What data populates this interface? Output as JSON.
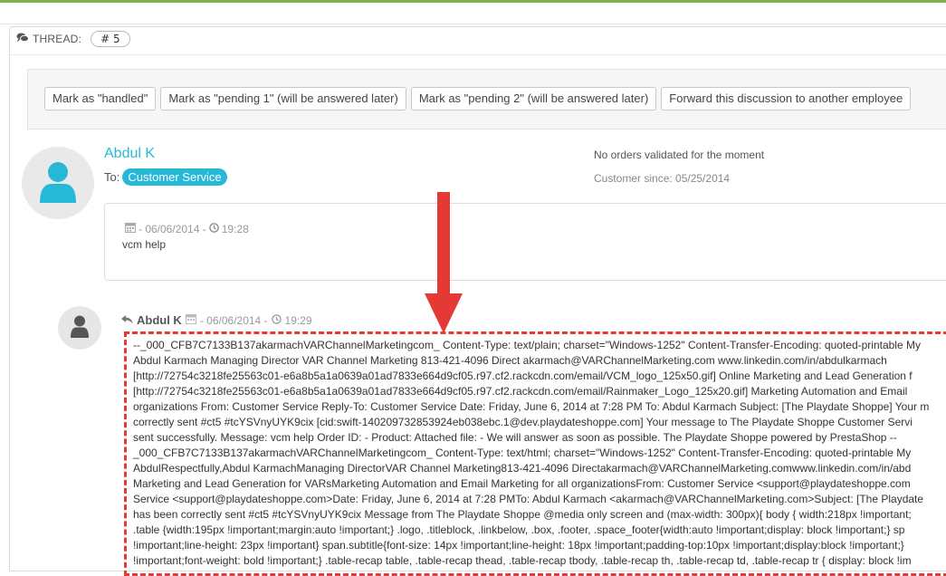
{
  "thread": {
    "label": "THREAD:",
    "number": "# 5"
  },
  "actions": [
    "Mark as \"handled\"",
    "Mark as \"pending 1\" (will be answered later)",
    "Mark as \"pending 2\" (will be answered later)",
    "Forward this discussion to another employee"
  ],
  "customer": {
    "name": "Abdul K",
    "to_label": "To:",
    "to_value": "Customer Service",
    "orders_note": "No orders validated for the moment",
    "customer_since": "Customer since: 05/25/2014"
  },
  "first_message": {
    "meta": "- 06/06/2014 - ",
    "time": "19:28",
    "text": "vcm help"
  },
  "reply": {
    "name": "Abdul K",
    "meta": "- 06/06/2014 - ",
    "time": "19:29",
    "body_lines": [
      "--_000_CFB7C7133B137akarmachVARChannelMarketingcom_ Content-Type: text/plain; charset=\"Windows-1252\" Content-Transfer-Encoding: quoted-printable My",
      "Abdul Karmach Managing Director VAR Channel Marketing 813-421-4096 Direct akarmach@VARChannelMarketing.com www.linkedin.com/in/abdulkarmach",
      "[http://72754c3218fe25563c01-e6a8b5a1a0639a01ad7833e664d9cf05.r97.cf2.rackcdn.com/email/VCM_logo_125x50.gif] Online Marketing and Lead Generation f",
      "[http://72754c3218fe25563c01-e6a8b5a1a0639a01ad7833e664d9cf05.r97.cf2.rackcdn.com/email/Rainmaker_Logo_125x20.gif] Marketing Automation and Email",
      "organizations From: Customer Service Reply-To: Customer Service Date: Friday, June 6, 2014 at 7:28 PM To: Abdul Karmach Subject: [The Playdate Shoppe] Your m",
      "correctly sent #ct5 #tcYSVnyUYK9cix [cid:swift-140209732853924eb038ebc.1@dev.playdateshoppe.com] Your message to The Playdate Shoppe Customer Servi",
      "sent successfully. Message: vcm help Order ID: - Product: Attached file: - We will answer as soon as possible. The Playdate Shoppe powered by PrestaShop --",
      "_000_CFB7C7133B137akarmachVARChannelMarketingcom_ Content-Type: text/html; charset=\"Windows-1252\" Content-Transfer-Encoding: quoted-printable My",
      "AbdulRespectfully,Abdul KarmachManaging DirectorVAR Channel Marketing813-421-4096 Directakarmach@VARChannelMarketing.comwww.linkedin.com/in/abd",
      "Marketing and Lead Generation for VARsMarketing Automation and Email Marketing for all organizationsFrom: Customer Service <support@playdateshoppe.com",
      "Service <support@playdateshoppe.com>Date: Friday, June 6, 2014 at 7:28 PMTo: Abdul Karmach <akarmach@VARChannelMarketing.com>Subject: [The Playdate",
      "has been correctly sent #ct5 #tcYSVnyUYK9cix Message from The Playdate Shoppe @media only screen and (max-width: 300px){ body { width:218px !important;",
      ".table {width:195px !important;margin:auto !important;} .logo, .titleblock, .linkbelow, .box, .footer, .space_footer{width:auto !important;display: block !important;} sp",
      "!important;line-height: 23px !important} span.subtitle{font-size: 14px !important;line-height: 18px !important;padding-top:10px !important;display:block !important;}",
      "!important;font-weight: bold !important;} .table-recap table, .table-recap thead, .table-recap tbody, .table-recap th, .table-recap td, .table-recap tr { display: block !im"
    ]
  },
  "colors": {
    "accent": "#25b9d7",
    "annotation": "#e53935",
    "topbar": "#7cb342"
  }
}
